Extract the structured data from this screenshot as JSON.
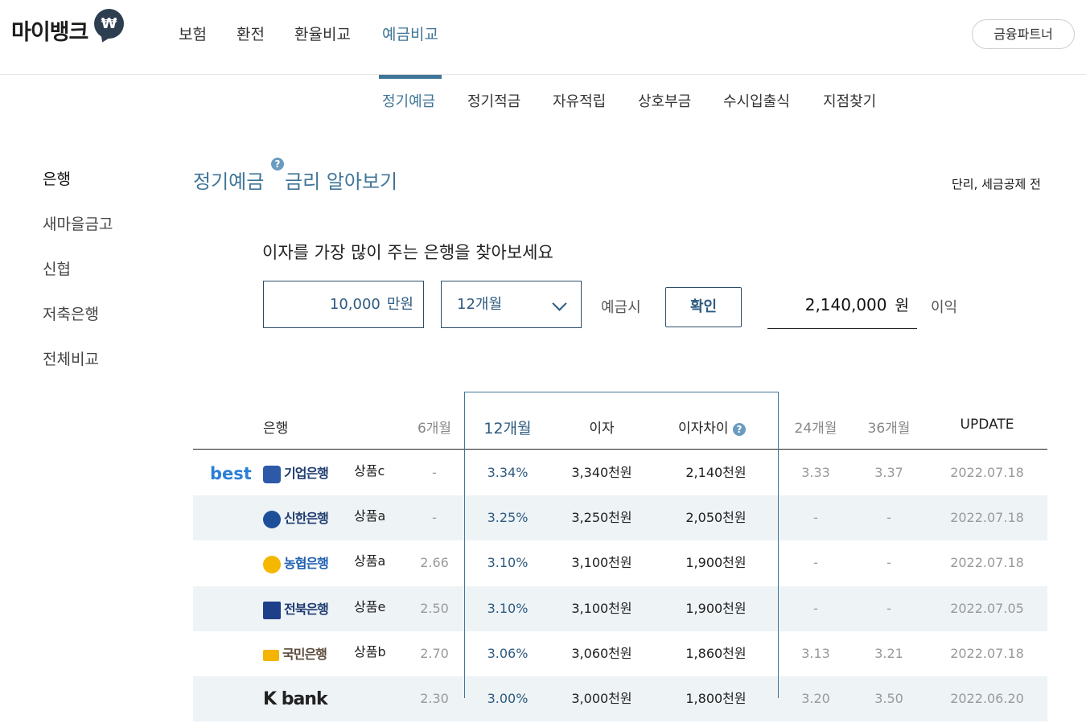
{
  "header": {
    "logo": "마이뱅크",
    "logo_badge": "₩",
    "nav": [
      "보험",
      "환전",
      "환율비교",
      "예금비교"
    ],
    "partner_button": "금융파트너"
  },
  "subnav": [
    "정기예금",
    "정기적금",
    "자유적립",
    "상호부금",
    "수시입출식",
    "지점찾기"
  ],
  "sidebar": [
    "은행",
    "새마을금고",
    "신협",
    "저축은행",
    "전체비교"
  ],
  "main": {
    "title_a": "정기예금",
    "title_b": "금리 알아보기",
    "help_mark": "?",
    "note": "단리, 세금공제 전",
    "prompt": "이자를 가장 많이 주는 은행을 찾아보세요",
    "amount_value": "10,000",
    "amount_unit": "만원",
    "period_selected": "12개월",
    "deposit_label": "예금시",
    "confirm_button": "확인",
    "result_value": "2,140,000",
    "result_unit": "원",
    "profit_label": "이익"
  },
  "table": {
    "headers": {
      "bank": "은행",
      "m6": "6개월",
      "m12": "12개월",
      "interest": "이자",
      "diff": "이자차이",
      "m24": "24개월",
      "m36": "36개월",
      "update": "UPDATE"
    },
    "best_label": "best",
    "rows": [
      {
        "bank": "기업은행",
        "product": "상품c",
        "m6": "-",
        "m12": "3.34%",
        "interest": "3,340천원",
        "diff": "2,140천원",
        "m24": "3.33",
        "m36": "3.37",
        "update": "2022.07.18"
      },
      {
        "bank": "신한은행",
        "product": "상품a",
        "m6": "-",
        "m12": "3.25%",
        "interest": "3,250천원",
        "diff": "2,050천원",
        "m24": "-",
        "m36": "-",
        "update": "2022.07.18"
      },
      {
        "bank": "농협은행",
        "product": "상품a",
        "m6": "2.66",
        "m12": "3.10%",
        "interest": "3,100천원",
        "diff": "1,900천원",
        "m24": "-",
        "m36": "-",
        "update": "2022.07.18"
      },
      {
        "bank": "전북은행",
        "product": "상품e",
        "m6": "2.50",
        "m12": "3.10%",
        "interest": "3,100천원",
        "diff": "1,900천원",
        "m24": "-",
        "m36": "-",
        "update": "2022.07.05"
      },
      {
        "bank": "국민은행",
        "product": "상품b",
        "m6": "2.70",
        "m12": "3.06%",
        "interest": "3,060천원",
        "diff": "1,860천원",
        "m24": "3.13",
        "m36": "3.21",
        "update": "2022.07.18"
      },
      {
        "bank": "K bank",
        "product": "",
        "m6": "2.30",
        "m12": "3.00%",
        "interest": "3,000천원",
        "diff": "1,800천원",
        "m24": "3.20",
        "m36": "3.50",
        "update": "2022.06.20"
      }
    ]
  },
  "colors": {
    "accent": "#3f7597",
    "best": "#2a7fd5",
    "row_shade": "#eef3f6"
  }
}
